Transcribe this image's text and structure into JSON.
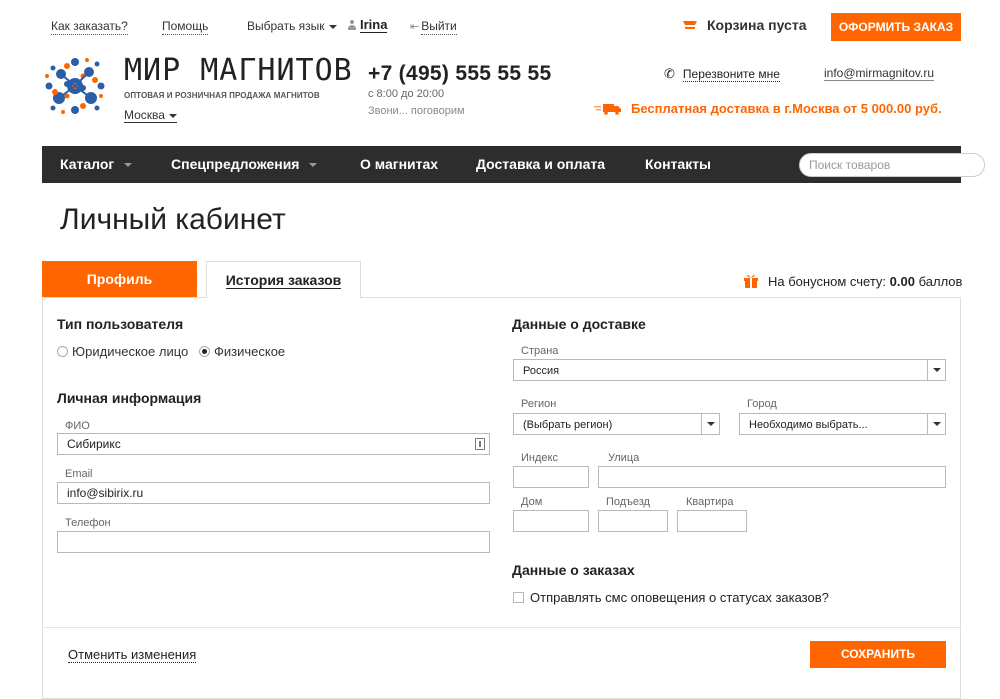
{
  "topbar": {
    "how_to_order": "Как заказать?",
    "help": "Помощь",
    "language": "Выбрать язык",
    "username": "Irina",
    "logout": "Выйти",
    "cart_status": "Корзина пуста",
    "checkout_button": "ОФОРМИТЬ ЗАКАЗ"
  },
  "header": {
    "brand": "МИР МАГНИТОВ",
    "tagline": "ОПТОВАЯ И РОЗНИЧНАЯ ПРОДАЖА МАГНИТОВ",
    "city": "Москва",
    "phone": "+7 (495) 555 55 55",
    "hours": "с 8:00 до 20:00",
    "call_note": "Звони... поговорим",
    "callback": "Перезвоните мне",
    "email": "info@mirmagnitov.ru",
    "delivery": "Бесплатная доставка в г.Москва от 5 000.00 руб."
  },
  "nav": {
    "items": [
      "Каталог",
      "Спецпредложения",
      "О магнитах",
      "Доставка и оплата",
      "Контакты"
    ],
    "search_placeholder": "Поиск товаров"
  },
  "page": {
    "title": "Личный кабинет",
    "tab_profile": "Профиль",
    "tab_history": "История заказов",
    "bonus_label": "На бонусном счету:",
    "bonus_value": "0.00",
    "bonus_unit": "баллов"
  },
  "profile": {
    "user_type_title": "Тип пользователя",
    "legal": "Юридическое лицо",
    "individual": "Физическое",
    "personal_title": "Личная информация",
    "fio_label": "ФИО",
    "fio_value": "Сибирикс",
    "email_label": "Email",
    "email_value": "info@sibirix.ru",
    "phone_label": "Телефон",
    "phone_value": ""
  },
  "delivery": {
    "title": "Данные о доставке",
    "country_label": "Страна",
    "country_value": "Россия",
    "region_label": "Регион",
    "region_value": "(Выбрать регион)",
    "city_label": "Город",
    "city_value": "Необходимо выбрать...",
    "index_label": "Индекс",
    "street_label": "Улица",
    "house_label": "Дом",
    "entrance_label": "Подъезд",
    "flat_label": "Квартира"
  },
  "orders": {
    "title": "Данные о заказах",
    "sms_label": "Отправлять смс оповещения о статусах заказов?"
  },
  "footer": {
    "cancel": "Отменить изменения",
    "save": "СОХРАНИТЬ"
  },
  "colors": {
    "accent": "#ff6600",
    "nav_bg": "#2d2d2d",
    "logo_blue": "#2a5fa8"
  }
}
